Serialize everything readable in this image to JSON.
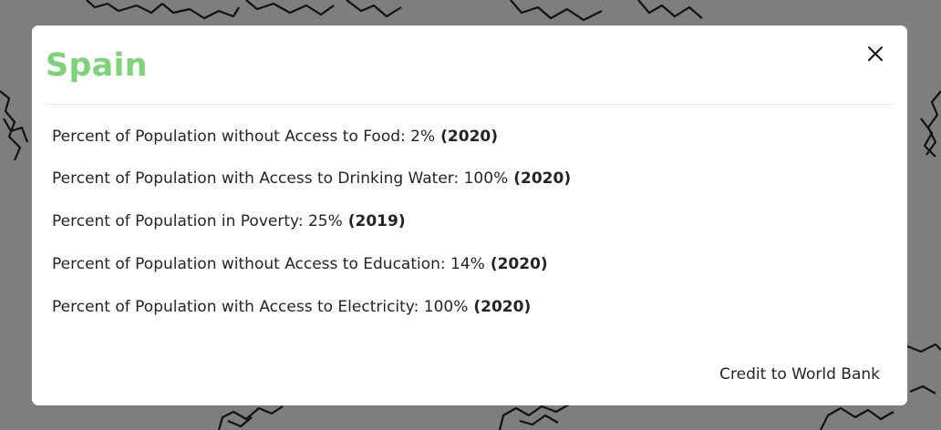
{
  "modal": {
    "title": "Spain",
    "title_color": "#7fd17a",
    "close_icon": "close-icon",
    "stats": [
      {
        "label": "Percent of Population without Access to Food: 2%",
        "year": "(2020)"
      },
      {
        "label": "Percent of Population with Access to Drinking Water: 100%",
        "year": "(2020)"
      },
      {
        "label": "Percent of Population in Poverty: 25%",
        "year": "(2019)"
      },
      {
        "label": "Percent of Population without Access to Education: 14%",
        "year": "(2020)"
      },
      {
        "label": "Percent of Population with Access to Electricity: 100%",
        "year": "(2020)"
      }
    ],
    "credit": "Credit to World Bank"
  },
  "backdrop": {
    "color": "#7d7e80",
    "content": "world-map-outline"
  }
}
